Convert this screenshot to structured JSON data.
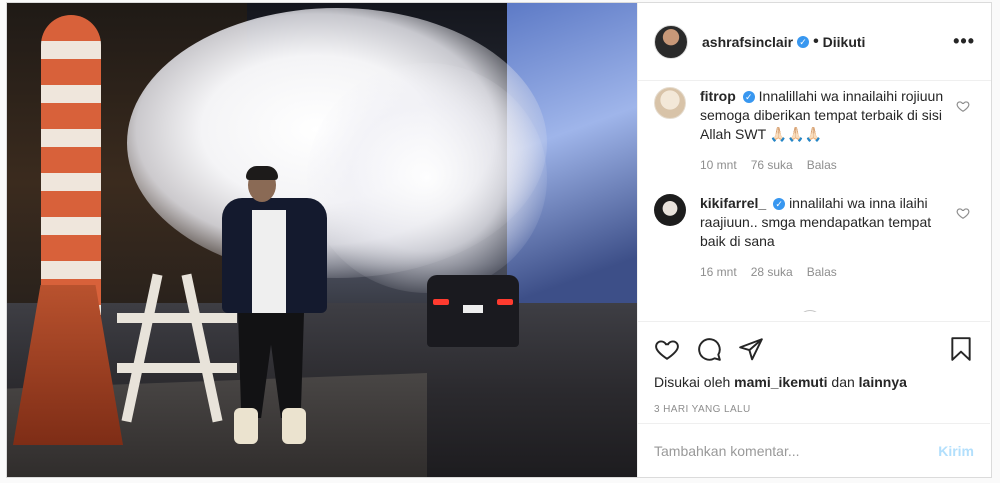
{
  "post": {
    "author": "ashrafsinclair",
    "follow_status": "Diikuti",
    "more_label": "•••"
  },
  "comments": [
    {
      "user": "fitrop",
      "text": "Innalillahi wa innailaihi rojiuun semoga diberikan tempat terbaik di sisi Allah SWT 🙏🏻🙏🏻🙏🏻",
      "time": "10 mnt",
      "likes": "76 suka",
      "reply": "Balas",
      "verified": true
    },
    {
      "user": "kikifarrel_",
      "text": "innalilahi wa inna ilaihi raajiuun.. smga mendapatkan tempat baik di sana",
      "time": "16 mnt",
      "likes": "28 suka",
      "reply": "Balas",
      "verified": true
    }
  ],
  "likes": {
    "prefix": "Disukai oleh",
    "user": "mami_ikemuti",
    "connector": "dan",
    "others": "lainnya"
  },
  "time_ago": "3 HARI YANG LALU",
  "add_comment": {
    "placeholder": "Tambahkan komentar...",
    "send_label": "Kirim"
  },
  "colors": {
    "verified": "#3897f0",
    "send_disabled": "#b2dffc",
    "meta_gray": "#8e8e8e"
  },
  "icons": [
    "heart-icon",
    "comment-icon",
    "share-icon",
    "bookmark-icon",
    "more-options-icon",
    "verified-icon"
  ]
}
